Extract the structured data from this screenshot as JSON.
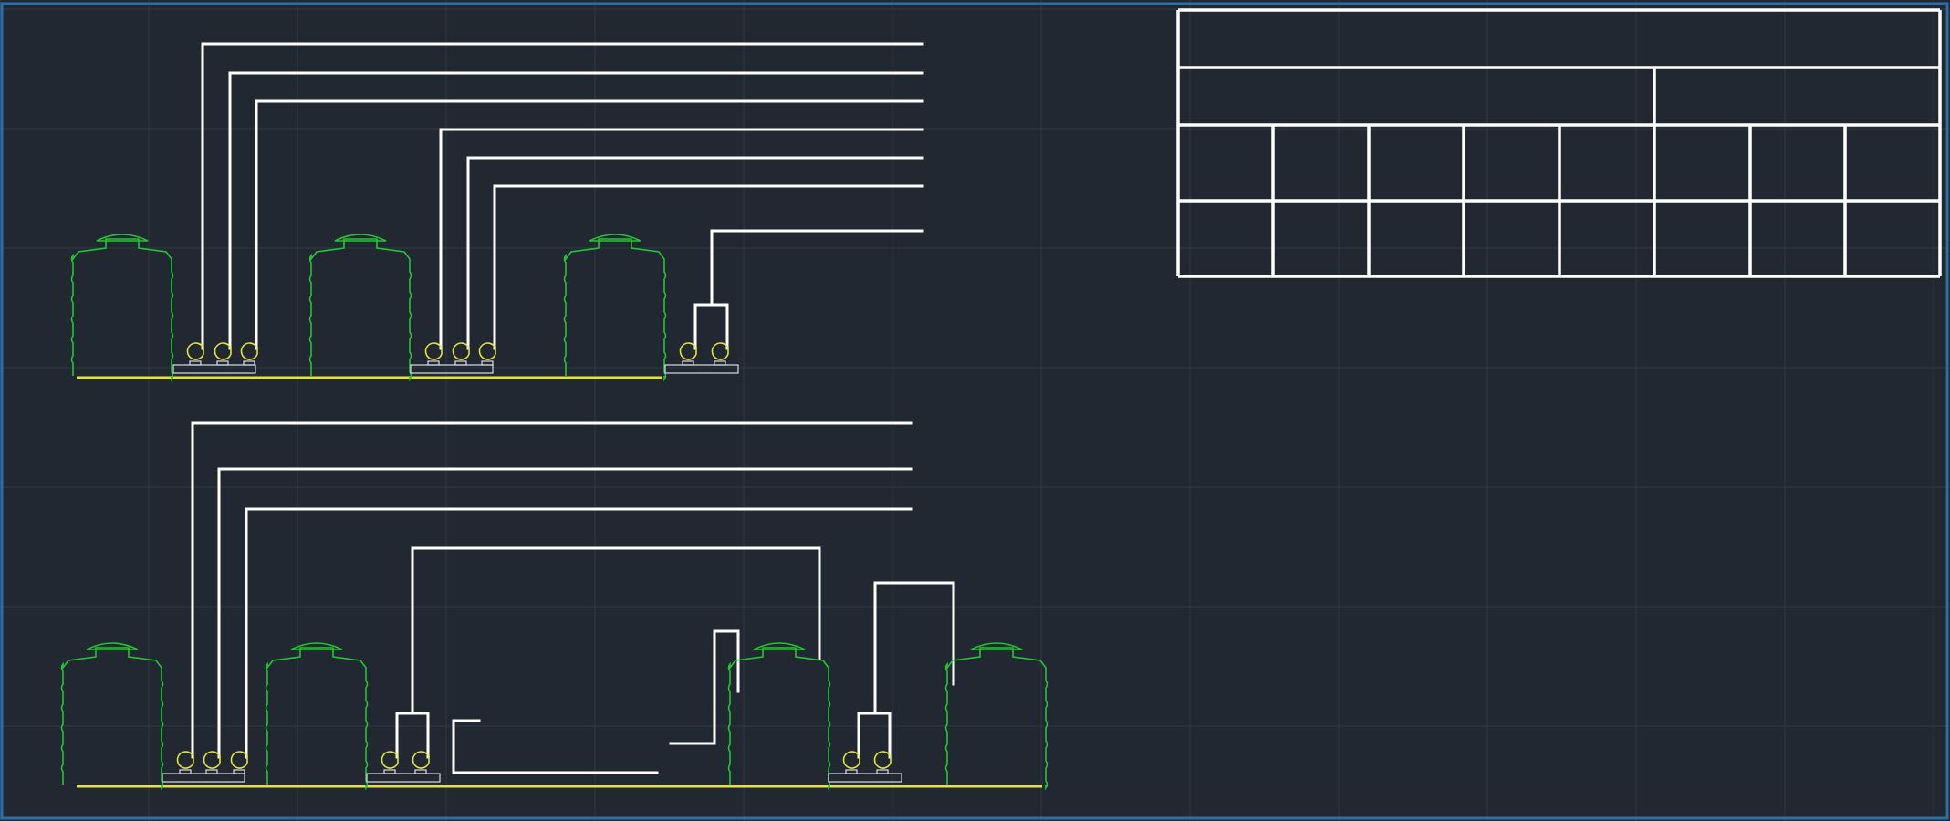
{
  "drawing": {
    "title": "",
    "background_color": "#222831",
    "grid_color": "#2f3a44",
    "frame_color": "#2a6fa8",
    "pipe_color": "#ffffff",
    "tank_color": "#22c533",
    "ground_color": "#e6e23a",
    "pump_color": "#e6e23a",
    "base_color": "#d8dde6",
    "upper_system": {
      "tank_count": 3,
      "pump_count": 8,
      "riser_count": 7
    },
    "lower_system": {
      "tank_count": 4,
      "pump_count": 7,
      "riser_count": 3
    },
    "title_block": {
      "rows": 4,
      "columns_lower_rows": 8,
      "cells_text": []
    }
  }
}
